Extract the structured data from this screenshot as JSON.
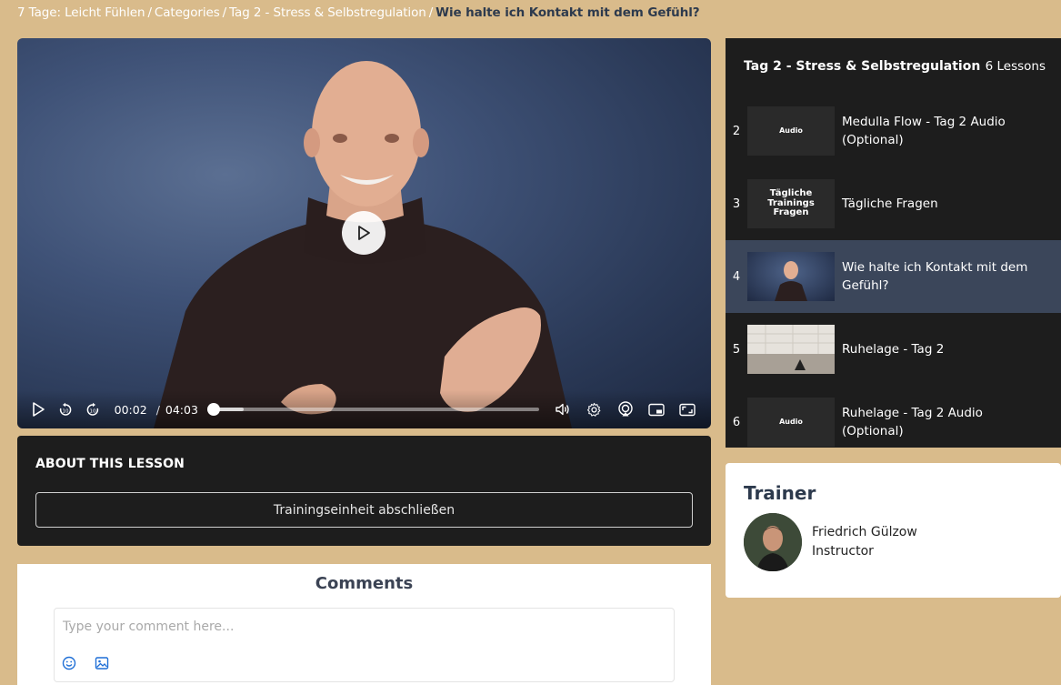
{
  "breadcrumb": {
    "items": [
      "7 Tage: Leicht Fühlen",
      "Categories",
      "Tag 2 - Stress & Selbstregulation"
    ],
    "current": "Wie halte ich Kontakt mit dem Gefühl?",
    "separator": "/"
  },
  "player": {
    "current_time": "00:02",
    "time_separator": "/",
    "duration": "04:03",
    "progress_fraction": 0.008
  },
  "about": {
    "title": "ABOUT THIS LESSON",
    "complete_button": "Trainingseinheit abschließen"
  },
  "comments": {
    "title": "Comments",
    "placeholder": "Type your comment here..."
  },
  "lessons": {
    "title": "Tag 2 - Stress & Selbstregulation",
    "count": "6 Lessons",
    "items": [
      {
        "num": "2",
        "title": "Medulla Flow - Tag 2 Audio (Optional)",
        "thumb_label": "Audio"
      },
      {
        "num": "3",
        "title": "Tägliche Fragen",
        "thumb_label": "Tägliche Trainings Fragen"
      },
      {
        "num": "4",
        "title": "Wie halte ich Kontakt mit dem Gefühl?",
        "thumb_label": ""
      },
      {
        "num": "5",
        "title": "Ruhelage - Tag 2",
        "thumb_label": ""
      },
      {
        "num": "6",
        "title": "Ruhelage - Tag 2 Audio (Optional)",
        "thumb_label": "Audio"
      }
    ]
  },
  "trainer": {
    "heading": "Trainer",
    "name": "Friedrich Gülzow",
    "role": "Instructor"
  }
}
